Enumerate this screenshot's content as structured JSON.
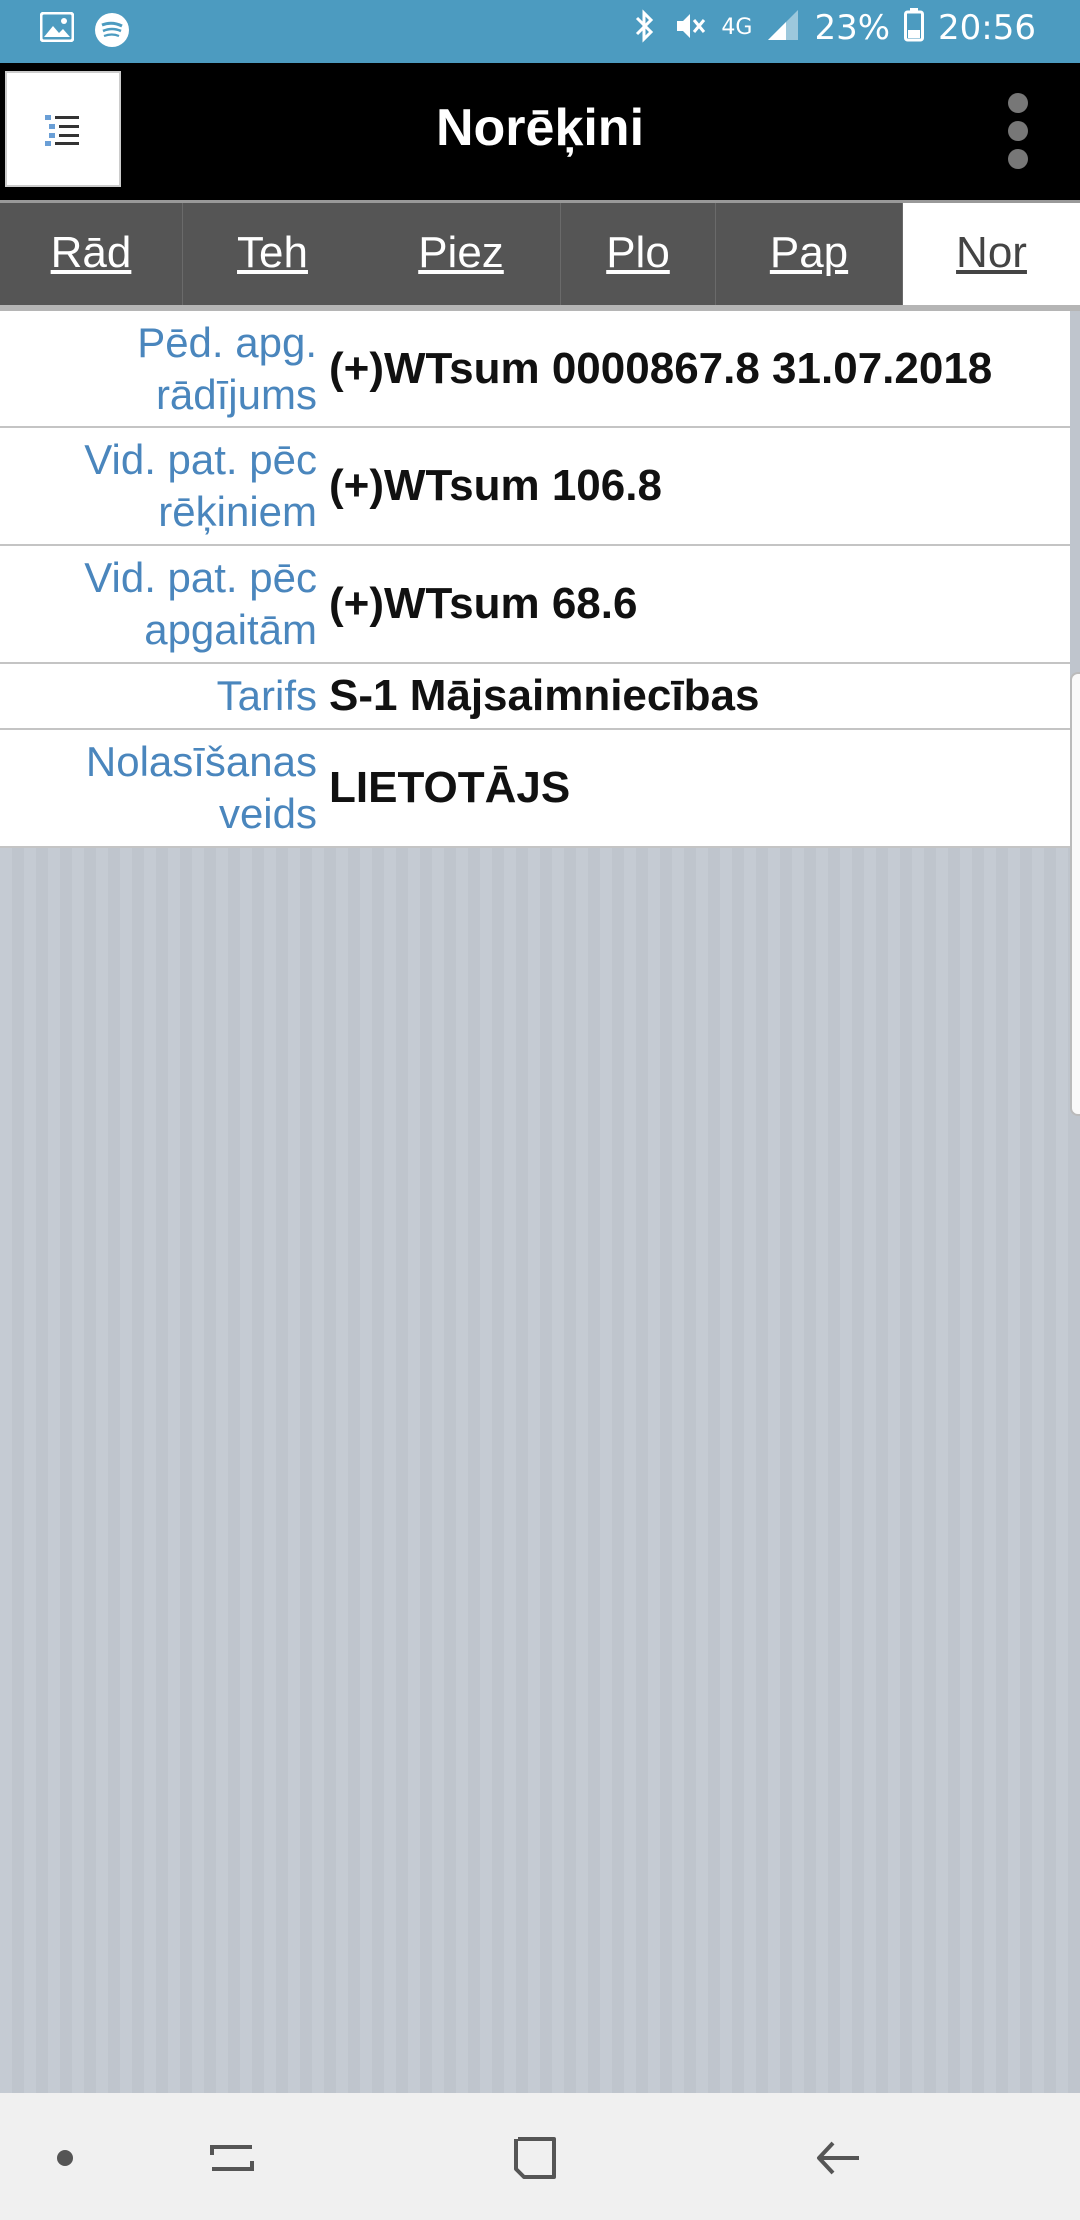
{
  "status_bar": {
    "time": "20:56",
    "battery": "23%",
    "network": "4G",
    "icons": [
      "gallery-icon",
      "spotify-icon",
      "bluetooth-icon",
      "mute-icon",
      "signal-icon",
      "battery-icon"
    ]
  },
  "app_bar": {
    "title": "Norēķini",
    "menu_icon": "list-icon",
    "overflow_icon": "more-vert-icon"
  },
  "tabs": [
    {
      "label": "Rād",
      "active": false
    },
    {
      "label": "Teh",
      "active": false
    },
    {
      "label": "Piez",
      "active": false
    },
    {
      "label": "Plo",
      "active": false
    },
    {
      "label": "Pap",
      "active": false
    },
    {
      "label": "Nor",
      "active": true
    }
  ],
  "rows": [
    {
      "label_line1": "Pēd. apg.",
      "label_line2": "rādījums",
      "value": "(+)WTsum 0000867.8 31.07.2018"
    },
    {
      "label_line1": "Vid. pat. pēc",
      "label_line2": "rēķiniem",
      "value": "(+)WTsum 106.8"
    },
    {
      "label_line1": "Vid. pat. pēc",
      "label_line2": "apgaitām",
      "value": "(+)WTsum 68.6"
    },
    {
      "label_line1": "Tarifs",
      "label_line2": "",
      "value": "S-1 Mājsaimniecības"
    },
    {
      "label_line1": "Nolasīšanas",
      "label_line2": "veids",
      "value": "LIETOTĀJS"
    }
  ],
  "nav_bar": {
    "icons": [
      "dot-icon",
      "recents-icon",
      "home-icon",
      "back-icon"
    ]
  },
  "colors": {
    "status_bar": "#4c9bc0",
    "app_bar": "#000000",
    "label": "#4a86bd",
    "tab_bg": "#555555"
  }
}
